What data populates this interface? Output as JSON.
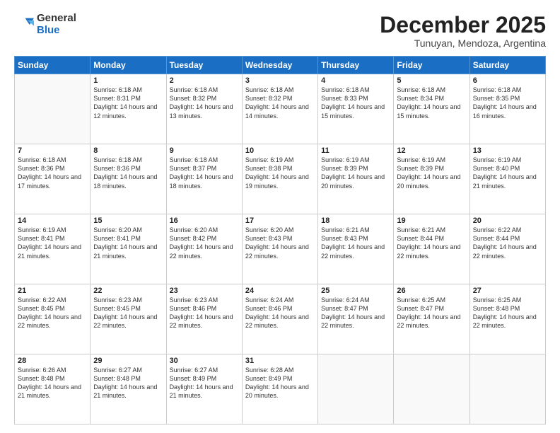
{
  "logo": {
    "general": "General",
    "blue": "Blue"
  },
  "header": {
    "month": "December 2025",
    "location": "Tunuyan, Mendoza, Argentina"
  },
  "weekdays": [
    "Sunday",
    "Monday",
    "Tuesday",
    "Wednesday",
    "Thursday",
    "Friday",
    "Saturday"
  ],
  "weeks": [
    [
      {
        "day": "",
        "sunrise": "",
        "sunset": "",
        "daylight": ""
      },
      {
        "day": "1",
        "sunrise": "Sunrise: 6:18 AM",
        "sunset": "Sunset: 8:31 PM",
        "daylight": "Daylight: 14 hours and 12 minutes."
      },
      {
        "day": "2",
        "sunrise": "Sunrise: 6:18 AM",
        "sunset": "Sunset: 8:32 PM",
        "daylight": "Daylight: 14 hours and 13 minutes."
      },
      {
        "day": "3",
        "sunrise": "Sunrise: 6:18 AM",
        "sunset": "Sunset: 8:32 PM",
        "daylight": "Daylight: 14 hours and 14 minutes."
      },
      {
        "day": "4",
        "sunrise": "Sunrise: 6:18 AM",
        "sunset": "Sunset: 8:33 PM",
        "daylight": "Daylight: 14 hours and 15 minutes."
      },
      {
        "day": "5",
        "sunrise": "Sunrise: 6:18 AM",
        "sunset": "Sunset: 8:34 PM",
        "daylight": "Daylight: 14 hours and 15 minutes."
      },
      {
        "day": "6",
        "sunrise": "Sunrise: 6:18 AM",
        "sunset": "Sunset: 8:35 PM",
        "daylight": "Daylight: 14 hours and 16 minutes."
      }
    ],
    [
      {
        "day": "7",
        "sunrise": "Sunrise: 6:18 AM",
        "sunset": "Sunset: 8:36 PM",
        "daylight": "Daylight: 14 hours and 17 minutes."
      },
      {
        "day": "8",
        "sunrise": "Sunrise: 6:18 AM",
        "sunset": "Sunset: 8:36 PM",
        "daylight": "Daylight: 14 hours and 18 minutes."
      },
      {
        "day": "9",
        "sunrise": "Sunrise: 6:18 AM",
        "sunset": "Sunset: 8:37 PM",
        "daylight": "Daylight: 14 hours and 18 minutes."
      },
      {
        "day": "10",
        "sunrise": "Sunrise: 6:19 AM",
        "sunset": "Sunset: 8:38 PM",
        "daylight": "Daylight: 14 hours and 19 minutes."
      },
      {
        "day": "11",
        "sunrise": "Sunrise: 6:19 AM",
        "sunset": "Sunset: 8:39 PM",
        "daylight": "Daylight: 14 hours and 20 minutes."
      },
      {
        "day": "12",
        "sunrise": "Sunrise: 6:19 AM",
        "sunset": "Sunset: 8:39 PM",
        "daylight": "Daylight: 14 hours and 20 minutes."
      },
      {
        "day": "13",
        "sunrise": "Sunrise: 6:19 AM",
        "sunset": "Sunset: 8:40 PM",
        "daylight": "Daylight: 14 hours and 21 minutes."
      }
    ],
    [
      {
        "day": "14",
        "sunrise": "Sunrise: 6:19 AM",
        "sunset": "Sunset: 8:41 PM",
        "daylight": "Daylight: 14 hours and 21 minutes."
      },
      {
        "day": "15",
        "sunrise": "Sunrise: 6:20 AM",
        "sunset": "Sunset: 8:41 PM",
        "daylight": "Daylight: 14 hours and 21 minutes."
      },
      {
        "day": "16",
        "sunrise": "Sunrise: 6:20 AM",
        "sunset": "Sunset: 8:42 PM",
        "daylight": "Daylight: 14 hours and 22 minutes."
      },
      {
        "day": "17",
        "sunrise": "Sunrise: 6:20 AM",
        "sunset": "Sunset: 8:43 PM",
        "daylight": "Daylight: 14 hours and 22 minutes."
      },
      {
        "day": "18",
        "sunrise": "Sunrise: 6:21 AM",
        "sunset": "Sunset: 8:43 PM",
        "daylight": "Daylight: 14 hours and 22 minutes."
      },
      {
        "day": "19",
        "sunrise": "Sunrise: 6:21 AM",
        "sunset": "Sunset: 8:44 PM",
        "daylight": "Daylight: 14 hours and 22 minutes."
      },
      {
        "day": "20",
        "sunrise": "Sunrise: 6:22 AM",
        "sunset": "Sunset: 8:44 PM",
        "daylight": "Daylight: 14 hours and 22 minutes."
      }
    ],
    [
      {
        "day": "21",
        "sunrise": "Sunrise: 6:22 AM",
        "sunset": "Sunset: 8:45 PM",
        "daylight": "Daylight: 14 hours and 22 minutes."
      },
      {
        "day": "22",
        "sunrise": "Sunrise: 6:23 AM",
        "sunset": "Sunset: 8:45 PM",
        "daylight": "Daylight: 14 hours and 22 minutes."
      },
      {
        "day": "23",
        "sunrise": "Sunrise: 6:23 AM",
        "sunset": "Sunset: 8:46 PM",
        "daylight": "Daylight: 14 hours and 22 minutes."
      },
      {
        "day": "24",
        "sunrise": "Sunrise: 6:24 AM",
        "sunset": "Sunset: 8:46 PM",
        "daylight": "Daylight: 14 hours and 22 minutes."
      },
      {
        "day": "25",
        "sunrise": "Sunrise: 6:24 AM",
        "sunset": "Sunset: 8:47 PM",
        "daylight": "Daylight: 14 hours and 22 minutes."
      },
      {
        "day": "26",
        "sunrise": "Sunrise: 6:25 AM",
        "sunset": "Sunset: 8:47 PM",
        "daylight": "Daylight: 14 hours and 22 minutes."
      },
      {
        "day": "27",
        "sunrise": "Sunrise: 6:25 AM",
        "sunset": "Sunset: 8:48 PM",
        "daylight": "Daylight: 14 hours and 22 minutes."
      }
    ],
    [
      {
        "day": "28",
        "sunrise": "Sunrise: 6:26 AM",
        "sunset": "Sunset: 8:48 PM",
        "daylight": "Daylight: 14 hours and 21 minutes."
      },
      {
        "day": "29",
        "sunrise": "Sunrise: 6:27 AM",
        "sunset": "Sunset: 8:48 PM",
        "daylight": "Daylight: 14 hours and 21 minutes."
      },
      {
        "day": "30",
        "sunrise": "Sunrise: 6:27 AM",
        "sunset": "Sunset: 8:49 PM",
        "daylight": "Daylight: 14 hours and 21 minutes."
      },
      {
        "day": "31",
        "sunrise": "Sunrise: 6:28 AM",
        "sunset": "Sunset: 8:49 PM",
        "daylight": "Daylight: 14 hours and 20 minutes."
      },
      {
        "day": "",
        "sunrise": "",
        "sunset": "",
        "daylight": ""
      },
      {
        "day": "",
        "sunrise": "",
        "sunset": "",
        "daylight": ""
      },
      {
        "day": "",
        "sunrise": "",
        "sunset": "",
        "daylight": ""
      }
    ]
  ]
}
